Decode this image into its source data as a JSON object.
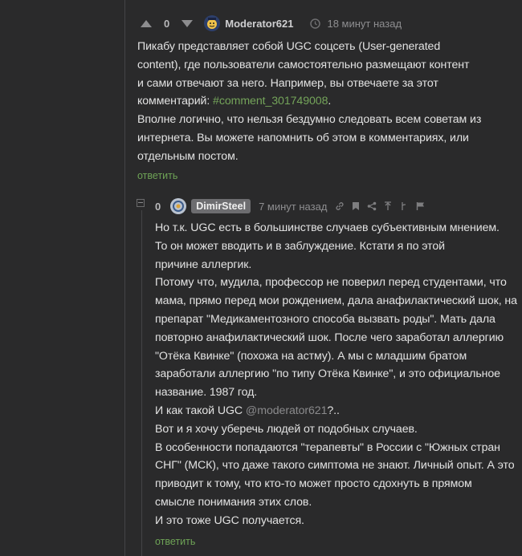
{
  "comment1": {
    "rating": "0",
    "author": "Moderator621",
    "time": "18 минут назад",
    "lines": [
      "Пикабу представляет собой UGC соцсеть (User-generated",
      "content), где пользователи самостоятельно размещают контент",
      "и сами отвечают за него. Например, вы отвечаете за этот",
      "комментарий: ",
      "Вполне логично, что нельзя бездумно следовать всем советам из",
      "интернета. Вы можете напомнить об этом в комментариях, или",
      "отдельным постом."
    ],
    "comment_link": "#comment_301749008",
    "comment_link_suffix": ".",
    "reply_label": "ответить"
  },
  "comment2": {
    "rating": "0",
    "author": "DimirSteel",
    "time": "7 минут назад",
    "lines": [
      "Но т.к. UGC есть в большинстве случаев субъективным мнением.",
      "То он может вводить и в заблуждение. Кстати я по этой",
      "причине аллергик.",
      "Потому что, мудила, профессор не поверил перед студентами, что",
      "мама, прямо перед мои рождением, дала анафилактический шок, на",
      "препарат \"Медикаментозного способа вызвать роды\". Мать дала",
      "повторно анафилактический шок. После чего заработал аллергию",
      "\"Отёка Квинке\" (похожа на астму). А мы с младшим братом",
      "заработали аллергию \"по типу Отёка Квинке\", и это официальное",
      "название. 1987 год.",
      "И как такой UGC ",
      "Вот и я хочу уберечь людей от подобных случаев.",
      "В особенности попадаются \"терапевты\" в России с \"Южных стран",
      "СНГ\" (МСК), что даже такого симптома не знают. Личный опыт. А это",
      "приводит к тому, что кто-то может просто сдохнуть в прямом",
      "смысле понимания этих слов.",
      "И это тоже UGC получается."
    ],
    "mention": "@moderator621",
    "mention_suffix": "?..",
    "reply_label": "ответить"
  },
  "icons": [
    "arrow-up-icon",
    "arrow-down-icon",
    "clock-icon",
    "link-icon",
    "bookmark-icon",
    "share-icon",
    "pin-icon",
    "branch-icon",
    "flag-icon"
  ]
}
